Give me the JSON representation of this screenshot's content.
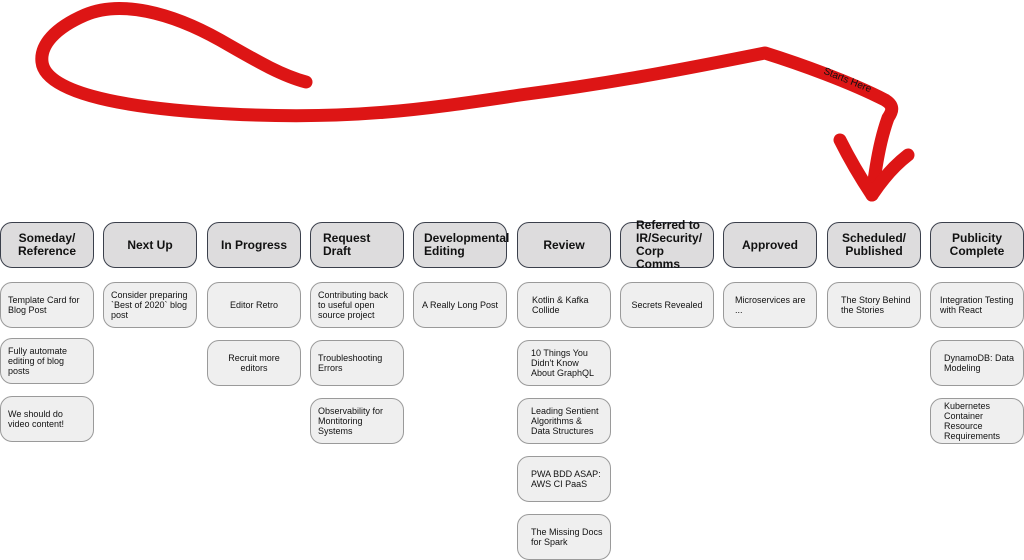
{
  "annotation": {
    "label": "Starts Here",
    "color": "#dd1515"
  },
  "columns": [
    {
      "title": "Someday/ Reference",
      "cards": [
        "Template Card for Blog Post",
        "Fully automate editing of blog posts",
        "We should do video content!"
      ]
    },
    {
      "title": "Next Up",
      "cards": [
        "Consider preparing `Best of 2020` blog post"
      ]
    },
    {
      "title": "In Progress",
      "cards": [
        "Editor Retro",
        "Recruit more editors"
      ]
    },
    {
      "title": "Request Draft",
      "cards": [
        "Contributing back to useful open source project",
        "Troubleshooting Errors",
        "Observability for Montitoring Systems"
      ]
    },
    {
      "title": "Developmental Editing",
      "cards": [
        "A Really Long Post"
      ]
    },
    {
      "title": "Review",
      "cards": [
        "Kotlin & Kafka Collide",
        "10 Things You Didn't Know About GraphQL",
        "Leading Sentient Algorithms & Data Structures",
        "PWA BDD ASAP: AWS CI PaaS",
        "The Missing Docs for Spark"
      ]
    },
    {
      "title": "Referred to IR/Security/ Corp Comms",
      "cards": [
        "Secrets Revealed"
      ]
    },
    {
      "title": "Approved",
      "cards": [
        "Microservices are ..."
      ]
    },
    {
      "title": "Scheduled/ Published",
      "cards": [
        "The Story Behind the Stories"
      ]
    },
    {
      "title": "Publicity Complete",
      "cards": [
        "Integration Testing with React",
        "DynamoDB: Data Modeling",
        "Kubernetes Container Resource Requirements"
      ]
    }
  ]
}
